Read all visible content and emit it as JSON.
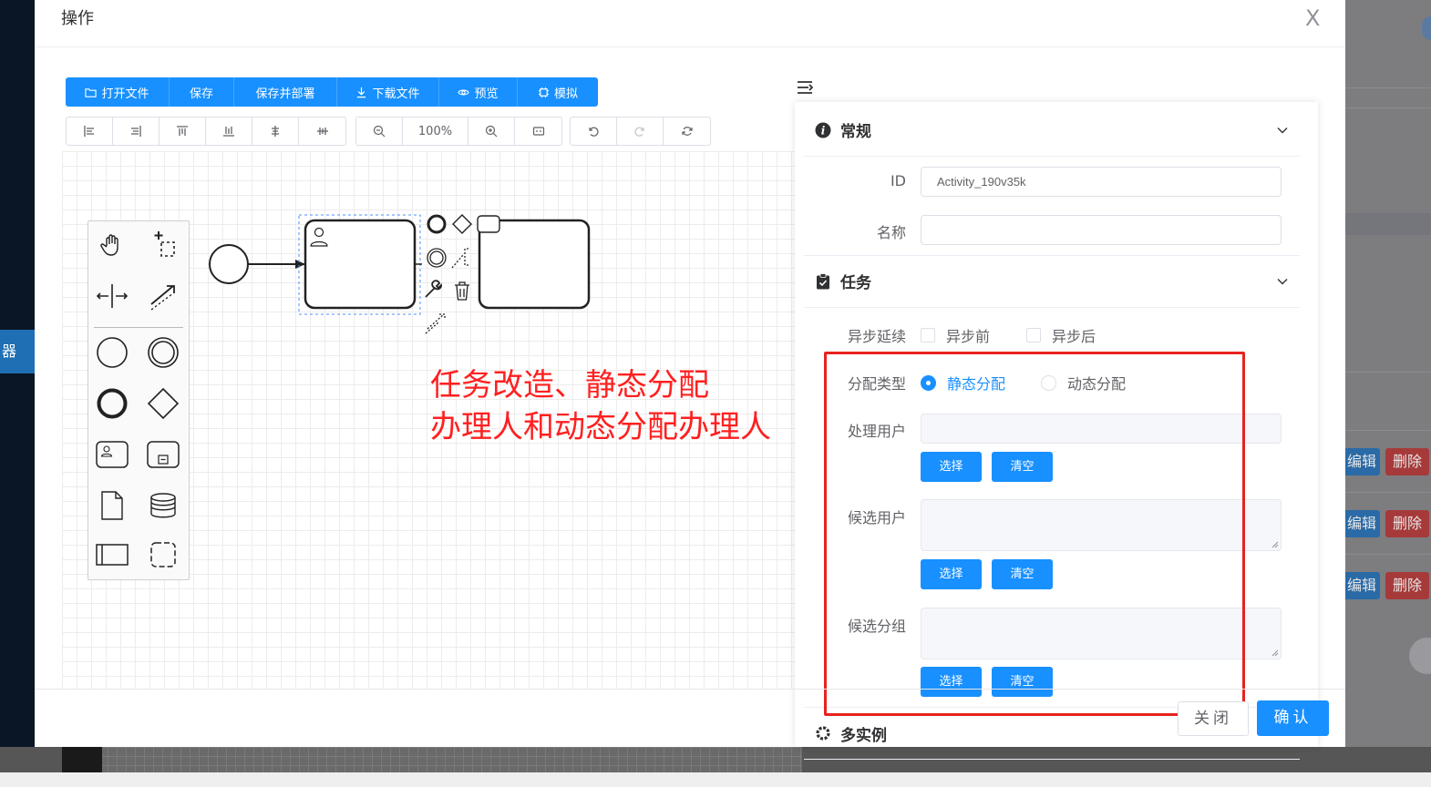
{
  "modal": {
    "title": "操作",
    "close_glyph": "X"
  },
  "toolbar": {
    "open_file": "打开文件",
    "save": "保存",
    "save_deploy": "保存并部署",
    "download": "下载文件",
    "preview": "预览",
    "simulate": "模拟"
  },
  "zoom": {
    "level": "100%"
  },
  "annotation": {
    "line1": "任务改造、静态分配",
    "line2": "办理人和动态分配办理人"
  },
  "panel": {
    "general": {
      "title": "常规",
      "id_label": "ID",
      "id_value": "Activity_190v35k",
      "name_label": "名称",
      "name_value": ""
    },
    "task": {
      "title": "任务",
      "async_label": "异步延续",
      "async_before": "异步前",
      "async_after": "异步后",
      "assign_type_label": "分配类型",
      "static_assign": "静态分配",
      "dynamic_assign": "动态分配",
      "assignee_label": "处理用户",
      "candidate_users_label": "候选用户",
      "candidate_groups_label": "候选分组",
      "select_label": "选择",
      "clear_label": "清空"
    },
    "multi_instance": {
      "title": "多实例"
    }
  },
  "footer": {
    "close": "关闭",
    "confirm": "确认"
  },
  "background": {
    "left_tab": "器",
    "edit": "编辑",
    "delete": "删除"
  },
  "colors": {
    "primary": "#1890ff",
    "annotation": "#ff2020",
    "highlight_box": "#e8221f"
  }
}
